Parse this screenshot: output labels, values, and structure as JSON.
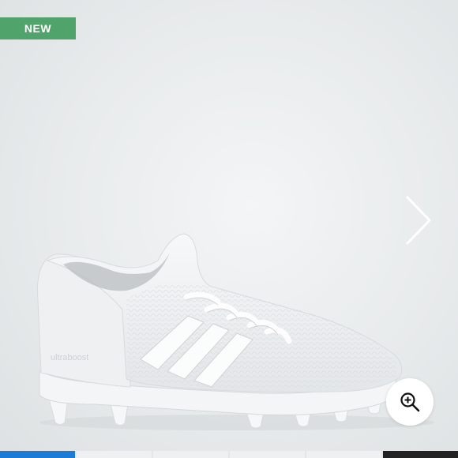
{
  "badge": {
    "label": "NEW",
    "color": "#4fa36b"
  },
  "product": {
    "image_label": "ultraboost",
    "image_icon": "white-football-cleat"
  },
  "controls": {
    "next_icon": "chevron-right-icon",
    "zoom_icon": "zoom-in-icon"
  },
  "gallery": {
    "total_images": 6,
    "current_image": 1,
    "active_color": "#1b7bd6",
    "end_color": "#222222"
  }
}
